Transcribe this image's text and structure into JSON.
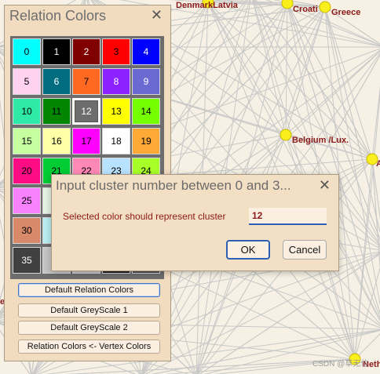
{
  "network": {
    "labels": {
      "denmark_latvia": "DenmarkLatvia",
      "croatia": "Croati",
      "greece": "Greece",
      "belgium": "Belgium /Lux.",
      "neth": "Neth",
      "left_edge": "ed",
      "right_edge": "A"
    },
    "node_color": "#f8ef1d",
    "edge_color": "#c8c8c8",
    "label_color": "#8b1a1a"
  },
  "watermark": "CSDN @草无位",
  "relation_colors": {
    "title": "Relation Colors",
    "close_glyph": "✕",
    "cells": [
      {
        "label": "0",
        "color": "#00ffff",
        "text_color": "#000000"
      },
      {
        "label": "1",
        "color": "#000000",
        "text_color": "#ffffff"
      },
      {
        "label": "2",
        "color": "#800000",
        "text_color": "#ffffff"
      },
      {
        "label": "3",
        "color": "#ff0000",
        "text_color": "#000000"
      },
      {
        "label": "4",
        "color": "#0000ff",
        "text_color": "#ffffff"
      },
      {
        "label": "5",
        "color": "#ffd3ef",
        "text_color": "#000000"
      },
      {
        "label": "6",
        "color": "#006c80",
        "text_color": "#ffffff"
      },
      {
        "label": "7",
        "color": "#ff6922",
        "text_color": "#000000"
      },
      {
        "label": "8",
        "color": "#8b22ff",
        "text_color": "#ffffff"
      },
      {
        "label": "9",
        "color": "#6a6ad2",
        "text_color": "#ffffff"
      },
      {
        "label": "10",
        "color": "#2fe9a8",
        "text_color": "#000000"
      },
      {
        "label": "11",
        "color": "#008600",
        "text_color": "#000000"
      },
      {
        "label": "12",
        "color": "#6d6d6d",
        "text_color": "#ffffff",
        "selected": true
      },
      {
        "label": "13",
        "color": "#ffff00",
        "text_color": "#000000"
      },
      {
        "label": "14",
        "color": "#76ff00",
        "text_color": "#000000"
      },
      {
        "label": "15",
        "color": "#c5ffa0",
        "text_color": "#000000"
      },
      {
        "label": "16",
        "color": "#ffffa8",
        "text_color": "#000000"
      },
      {
        "label": "17",
        "color": "#ff00ff",
        "text_color": "#000000"
      },
      {
        "label": "18",
        "color": "#ffffff",
        "text_color": "#000000"
      },
      {
        "label": "19",
        "color": "#ffa936",
        "text_color": "#000000"
      },
      {
        "label": "20",
        "color": "#ff0c85",
        "text_color": "#000000"
      },
      {
        "label": "21",
        "color": "#00cc33",
        "text_color": "#000000"
      },
      {
        "label": "22",
        "color": "#ff88b6",
        "text_color": "#000000"
      },
      {
        "label": "23",
        "color": "#b8e2ff",
        "text_color": "#000000"
      },
      {
        "label": "24",
        "color": "#a8ff28",
        "text_color": "#000000"
      },
      {
        "label": "25",
        "color": "#f881ff",
        "text_color": "#000000"
      },
      {
        "label": "",
        "color": "#e3f4e3",
        "text_color": "#000000"
      },
      {
        "label": "",
        "color": "#e3e3e3",
        "text_color": "#000000"
      },
      {
        "label": "",
        "color": "#e3e3e3",
        "text_color": "#000000"
      },
      {
        "label": "",
        "color": "#e3e3e3",
        "text_color": "#000000"
      },
      {
        "label": "30",
        "color": "#d8896a",
        "text_color": "#000000"
      },
      {
        "label": "",
        "color": "#b8eef0",
        "text_color": "#000000"
      },
      {
        "label": "",
        "color": "#e3e3e3",
        "text_color": "#000000"
      },
      {
        "label": "",
        "color": "#e3e3e3",
        "text_color": "#000000"
      },
      {
        "label": "",
        "color": "#e3e3e3",
        "text_color": "#000000"
      },
      {
        "label": "35",
        "color": "#404040",
        "text_color": "#ffffff"
      },
      {
        "label": "",
        "color": "#c4c4c4",
        "text_color": "#000000"
      },
      {
        "label": "",
        "color": "#c4c4c4",
        "text_color": "#000000"
      },
      {
        "label": "",
        "color": "#1a1a1a",
        "text_color": "#ffffff"
      },
      {
        "label": "",
        "color": "#4a4a4a",
        "text_color": "#ffffff"
      }
    ],
    "buttons": {
      "default_relation": "Default Relation Colors",
      "default_greyscale_1": "Default GreyScale 1",
      "default_greyscale_2": "Default GreyScale 2",
      "vertex_colors": "Relation Colors <- Vertex Colors"
    }
  },
  "dialog": {
    "title": "Input cluster number between 0 and 3...",
    "close_glyph": "✕",
    "prompt": "Selected color should represent cluster",
    "value": "12",
    "ok_label": "OK",
    "cancel_label": "Cancel"
  }
}
